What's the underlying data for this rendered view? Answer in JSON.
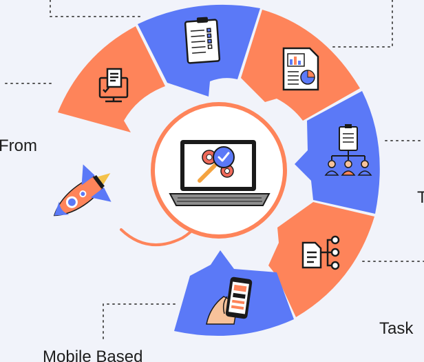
{
  "labels": {
    "left": "From",
    "task": "Task",
    "mobile": "Mobile Based",
    "right_partial": "T"
  },
  "colors": {
    "background": "#f1f3fa",
    "orange": "#fe845a",
    "blue": "#5b79f7",
    "ring": "#fe845a",
    "dots": "#555555"
  },
  "segments": [
    {
      "id": "segment-monitor",
      "color": "orange",
      "icon": "monitor-document-icon"
    },
    {
      "id": "segment-checklist",
      "color": "blue",
      "icon": "clipboard-checklist-icon"
    },
    {
      "id": "segment-report",
      "color": "orange",
      "icon": "report-chart-icon"
    },
    {
      "id": "segment-team",
      "color": "blue",
      "icon": "team-hierarchy-icon"
    },
    {
      "id": "segment-workflow",
      "color": "orange",
      "icon": "document-workflow-icon"
    },
    {
      "id": "segment-mobile",
      "color": "blue",
      "icon": "mobile-hand-icon"
    }
  ],
  "center": {
    "icon": "laptop-testing-icon"
  },
  "decoration": {
    "icon": "rocket-icon"
  }
}
